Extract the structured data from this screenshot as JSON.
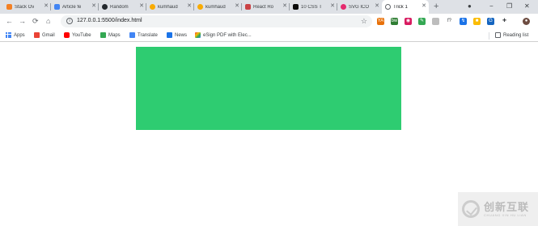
{
  "browser": {
    "tabs": [
      {
        "label": "Stack Ov",
        "icon": "stackoverflow-icon",
        "color": "#f48024",
        "active": false
      },
      {
        "label": "Article fe",
        "icon": "document-icon",
        "color": "#4285f4",
        "active": false
      },
      {
        "label": "Random",
        "icon": "github-icon",
        "color": "#24292e",
        "active": false
      },
      {
        "label": "kumhaud",
        "icon": "emoji-icon",
        "color": "#f9ab00",
        "active": false
      },
      {
        "label": "kumhaud",
        "icon": "emoji-icon",
        "color": "#f9ab00",
        "active": false
      },
      {
        "label": "React Ro",
        "icon": "react-router-icon",
        "color": "#ca4245",
        "active": false
      },
      {
        "label": "10 CSS T",
        "icon": "dev-icon",
        "color": "#0a0a0a",
        "active": false
      },
      {
        "label": "SVG ICO",
        "icon": "svg-icon",
        "color": "#e52b6e",
        "active": false
      },
      {
        "label": "Trick 1",
        "icon": "globe-icon",
        "color": "#5f6368",
        "active": true
      }
    ],
    "new_tab_symbol": "+",
    "window_controls": {
      "record": "●",
      "minimize": "−",
      "maximize": "❐",
      "close": "✕"
    },
    "toolbar": {
      "back": "←",
      "forward": "→",
      "reload": "⟳",
      "home": "⌂",
      "url": "127.0.0.1:5500/index.html",
      "info_symbol": "i",
      "star": "☆"
    },
    "extensions": [
      {
        "name": "ext-orange-icon",
        "color": "#e8710a",
        "glyph": "YA"
      },
      {
        "name": "ext-bw-icon",
        "color": "#2e7d32",
        "glyph": "bw"
      },
      {
        "name": "ext-pink-icon",
        "color": "#d81b60",
        "glyph": "◉"
      },
      {
        "name": "ext-green-icon",
        "color": "#34a853",
        "glyph": "✎"
      },
      {
        "name": "ext-grey-icon",
        "color": "#bdbdbd",
        "glyph": ""
      },
      {
        "name": "ext-script-icon",
        "color": "#ffffff",
        "glyph": "f?"
      },
      {
        "name": "ext-blue-icon",
        "color": "#1a73e8",
        "glyph": "↯"
      },
      {
        "name": "ext-multicolor-icon",
        "color": "#fbbc04",
        "glyph": "■"
      },
      {
        "name": "ext-grammar-icon",
        "color": "#1565c0",
        "glyph": "G"
      },
      {
        "name": "ext-puzzle-icon",
        "color": "#ffffff",
        "glyph": "✚"
      },
      {
        "name": "profile-avatar",
        "color": "#6d4c41",
        "glyph": "●"
      },
      {
        "name": "menu-icon",
        "color": "#ffffff",
        "glyph": "⋮"
      }
    ],
    "bookmarks": [
      {
        "label": "Apps",
        "icon": "apps-grid-icon",
        "color": "#4285f4"
      },
      {
        "label": "Gmail",
        "icon": "gmail-icon",
        "color": "#ea4335"
      },
      {
        "label": "YouTube",
        "icon": "youtube-icon",
        "color": "#ff0000"
      },
      {
        "label": "Maps",
        "icon": "maps-icon",
        "color": "#34a853"
      },
      {
        "label": "Translate",
        "icon": "translate-icon",
        "color": "#4285f4"
      },
      {
        "label": "News",
        "icon": "news-icon",
        "color": "#1a73e8"
      },
      {
        "label": "eSign PDF with Elec...",
        "icon": "esign-icon",
        "color": "#f4b400"
      }
    ],
    "reading_list": {
      "label": "Reading list",
      "icon": "reading-list-icon"
    }
  },
  "page": {
    "box_color": "#2ecc71"
  },
  "watermark": {
    "chinese": "创新互联",
    "english": "CHUANG XIN HU LIAN"
  }
}
